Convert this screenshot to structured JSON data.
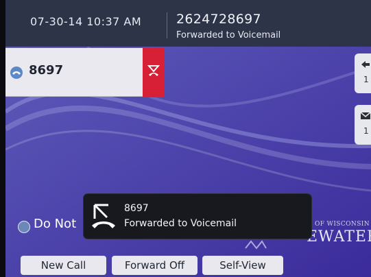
{
  "header": {
    "datetime": "07-30-14 10:37 AM",
    "caller_number": "2624728697",
    "caller_status": "Forwarded to Voicemail"
  },
  "line": {
    "label": "8697",
    "icon": "phone-handset-icon",
    "status_icon": "missed-call-icon",
    "status_color": "#d71f35"
  },
  "right_keys": [
    {
      "icon": "call-history-icon",
      "count": "1"
    },
    {
      "icon": "voicemail-icon",
      "count": "1"
    }
  ],
  "dnd": {
    "label": "Do Not",
    "icon": "do-not-disturb-icon"
  },
  "toast": {
    "line1": "8697",
    "line2": "Forwarded to Voicemail",
    "icon": "call-forward-icon"
  },
  "watermark": {
    "top": "OF WISCONSIN",
    "bottom": "EWATER"
  },
  "softkeys": [
    {
      "label": "New Call"
    },
    {
      "label": "Forward Off"
    },
    {
      "label": "Self-View"
    }
  ],
  "colors": {
    "screen": "#4a3fa6",
    "header": "#2d3447",
    "toast": "#17191f"
  }
}
